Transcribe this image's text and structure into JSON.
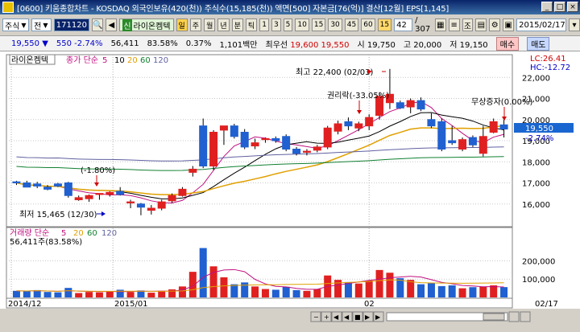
{
  "window": {
    "title": "[0600] 키움종합차트 - KOSDAQ 외국인보유(420(천)) 주식수(15,185(천)) 액면[500] 자본금[76(억)] 결산[12월] EPS[1,145]",
    "minimize": "_",
    "maximize": "□",
    "close": "×"
  },
  "toolbar": {
    "market": "주식",
    "whole": "전",
    "code": "171120",
    "stock_name": "라이온켐텍",
    "stock_prefix": "신",
    "period_buttons": [
      "일",
      "주",
      "월",
      "년",
      "분",
      "틱"
    ],
    "interval_buttons": [
      "1",
      "3",
      "5",
      "10",
      "15",
      "30",
      "45",
      "60"
    ],
    "selected_interval": "15",
    "count_value": "42",
    "count_total": "/ 307",
    "date": "2015/02/17",
    "view_label": "조"
  },
  "quote": {
    "price": "19,550",
    "change_arrow": "▼",
    "change": "550",
    "change_pct": "-2.74%",
    "volume": "56,411",
    "volume_ratio": "83.58%",
    "turnover": "0.37%",
    "amount": "1,101백만",
    "best_ask_label": "최우선",
    "best_ask1": "19,600",
    "best_ask2": "19,550",
    "open_label": "시",
    "open": "19,750",
    "high_label": "고",
    "high": "20,000",
    "low_label": "저",
    "low": "19,150",
    "buy": "매수",
    "sell": "매도"
  },
  "price_panel": {
    "legend_name": "라이온켐텍",
    "legend_ma_label": "종가 단순",
    "ma_periods": [
      "5",
      "10",
      "20",
      "60",
      "120"
    ],
    "ma_colors": [
      "#c01080",
      "#000000",
      "#e0a000",
      "#108030",
      "#6060a0"
    ],
    "lc_label": "LC:26.41",
    "hc_label": "HC:-12.72",
    "y_ticks": [
      "22,000",
      "21,000",
      "20,000",
      "19,000",
      "18,000",
      "17,000",
      "16,000"
    ],
    "current_price_tag": "19,550",
    "current_change_tag": "-2.74%",
    "annotations": {
      "high": "최고 22,400 (02/03)",
      "low": "최저 15,465 (12/30)",
      "pct1": "(-1.80%)",
      "rights": "권리락(-33.05%)",
      "bonus": "무상증자(0.00%)"
    }
  },
  "volume_panel": {
    "legend_label": "거래량 단순",
    "ma_periods": [
      "5",
      "20",
      "60",
      "120"
    ],
    "volume_text": "56,411주(83.58%)",
    "y_ticks": [
      "200,000",
      "100,000"
    ]
  },
  "x_axis": {
    "labels": [
      "2014/12",
      "2015/01",
      "02",
      "02/17"
    ]
  },
  "colors": {
    "up": "#e02020",
    "down": "#2060d0",
    "title_bg": "#0a246a"
  },
  "chart_data": {
    "type": "candlestick",
    "unit": "KRW",
    "candles": [
      {
        "o": 17050,
        "h": 17100,
        "l": 16900,
        "c": 17000
      },
      {
        "o": 17000,
        "h": 17100,
        "l": 16800,
        "c": 16800
      },
      {
        "o": 16950,
        "h": 17050,
        "l": 16750,
        "c": 16850
      },
      {
        "o": 16800,
        "h": 16900,
        "l": 16650,
        "c": 16700
      },
      {
        "o": 16950,
        "h": 17000,
        "l": 16800,
        "c": 16850
      },
      {
        "o": 17000,
        "h": 17050,
        "l": 16300,
        "c": 16400
      },
      {
        "o": 16200,
        "h": 16400,
        "l": 16150,
        "c": 16300
      },
      {
        "o": 16250,
        "h": 16450,
        "l": 16100,
        "c": 16400
      },
      {
        "o": 16450,
        "h": 16500,
        "l": 16200,
        "c": 16500
      },
      {
        "o": 16450,
        "h": 16600,
        "l": 16350,
        "c": 16550
      },
      {
        "o": 16600,
        "h": 16800,
        "l": 16400,
        "c": 16450
      },
      {
        "o": 16050,
        "h": 16200,
        "l": 15800,
        "c": 16100
      },
      {
        "o": 16000,
        "h": 16050,
        "l": 15465,
        "c": 15850
      },
      {
        "o": 15700,
        "h": 15950,
        "l": 15500,
        "c": 15800
      },
      {
        "o": 15800,
        "h": 16200,
        "l": 15700,
        "c": 16100
      },
      {
        "o": 16150,
        "h": 16500,
        "l": 16050,
        "c": 16400
      },
      {
        "o": 16400,
        "h": 16800,
        "l": 16350,
        "c": 16700
      },
      {
        "o": 17500,
        "h": 17800,
        "l": 17300,
        "c": 17650
      },
      {
        "o": 19700,
        "h": 20050,
        "l": 17700,
        "c": 17800
      },
      {
        "o": 17800,
        "h": 19500,
        "l": 17600,
        "c": 19400
      },
      {
        "o": 19500,
        "h": 19700,
        "l": 18800,
        "c": 19700
      },
      {
        "o": 19700,
        "h": 19800,
        "l": 19100,
        "c": 19200
      },
      {
        "o": 19400,
        "h": 19550,
        "l": 18600,
        "c": 18700
      },
      {
        "o": 18750,
        "h": 19100,
        "l": 18600,
        "c": 18900
      },
      {
        "o": 19050,
        "h": 19150,
        "l": 18900,
        "c": 19100
      },
      {
        "o": 19100,
        "h": 19200,
        "l": 18900,
        "c": 19000
      },
      {
        "o": 19200,
        "h": 19300,
        "l": 18500,
        "c": 18600
      },
      {
        "o": 18600,
        "h": 18700,
        "l": 18300,
        "c": 18400
      },
      {
        "o": 18450,
        "h": 18600,
        "l": 18300,
        "c": 18500
      },
      {
        "o": 18550,
        "h": 18800,
        "l": 18450,
        "c": 18700
      },
      {
        "o": 18700,
        "h": 19700,
        "l": 18600,
        "c": 19600
      },
      {
        "o": 19450,
        "h": 19950,
        "l": 19300,
        "c": 19800
      },
      {
        "o": 19900,
        "h": 20100,
        "l": 19500,
        "c": 19700
      },
      {
        "o": 19600,
        "h": 19900,
        "l": 19450,
        "c": 19800
      },
      {
        "o": 19700,
        "h": 20250,
        "l": 19500,
        "c": 20100
      },
      {
        "o": 20200,
        "h": 21300,
        "l": 20000,
        "c": 21100
      },
      {
        "o": 20800,
        "h": 22400,
        "l": 20500,
        "c": 21200
      },
      {
        "o": 20800,
        "h": 20900,
        "l": 20500,
        "c": 20550
      },
      {
        "o": 20600,
        "h": 21000,
        "l": 20300,
        "c": 20900
      },
      {
        "o": 20900,
        "h": 21050,
        "l": 20400,
        "c": 20500
      },
      {
        "o": 20000,
        "h": 20300,
        "l": 19600,
        "c": 19700
      },
      {
        "o": 19900,
        "h": 20050,
        "l": 18500,
        "c": 18600
      },
      {
        "o": 19000,
        "h": 19700,
        "l": 18800,
        "c": 18900
      },
      {
        "o": 18600,
        "h": 19150,
        "l": 18500,
        "c": 19050
      },
      {
        "o": 19150,
        "h": 19250,
        "l": 18700,
        "c": 18800
      },
      {
        "o": 18400,
        "h": 19700,
        "l": 18250,
        "c": 19200
      },
      {
        "o": 19400,
        "h": 20050,
        "l": 19350,
        "c": 19900
      },
      {
        "o": 19750,
        "h": 20000,
        "l": 19150,
        "c": 19550
      }
    ],
    "volume": [
      36000,
      34000,
      40000,
      30000,
      28000,
      52000,
      24000,
      30000,
      28000,
      32000,
      42000,
      30000,
      38000,
      26000,
      36000,
      44000,
      60000,
      140000,
      270000,
      170000,
      110000,
      72000,
      82000,
      60000,
      46000,
      42000,
      58000,
      40000,
      36000,
      46000,
      120000,
      96000,
      84000,
      76000,
      92000,
      150000,
      135000,
      105000,
      96000,
      72000,
      78000,
      62000,
      66000,
      50000,
      56000,
      58000,
      66000,
      56411
    ],
    "ylim_price": [
      15000,
      23000
    ],
    "ylim_volume": [
      0,
      290000
    ]
  }
}
